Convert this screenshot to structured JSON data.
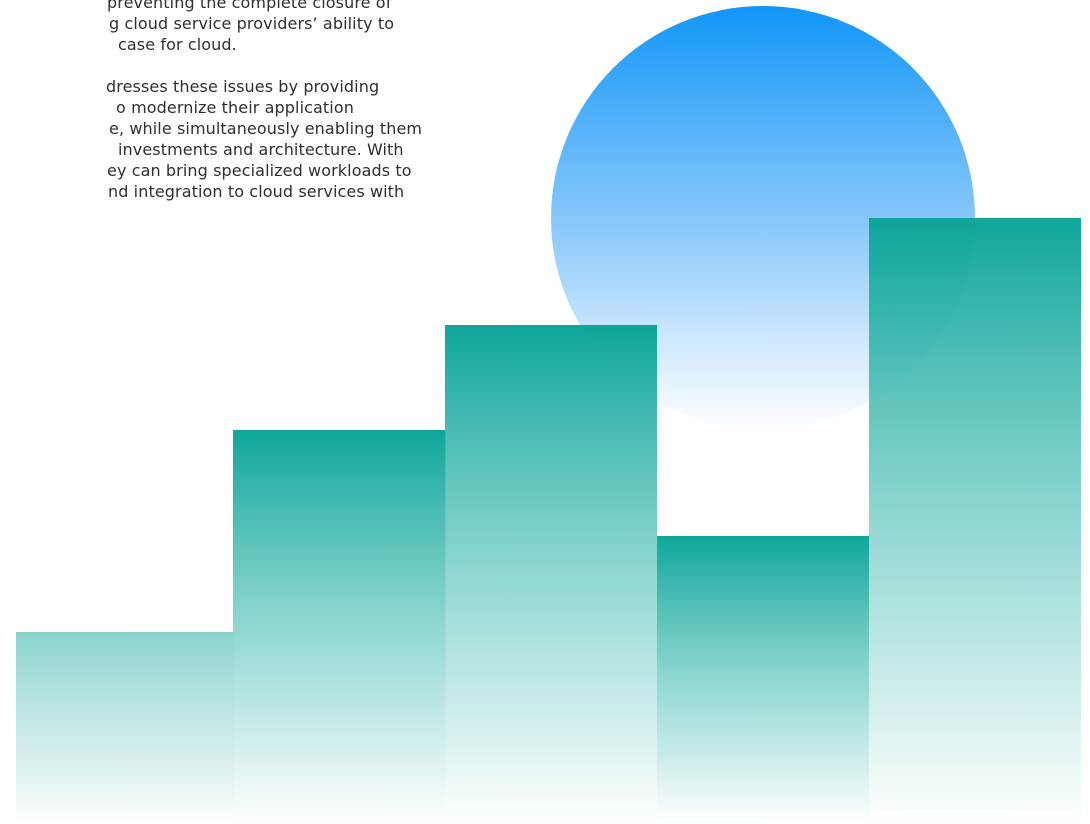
{
  "text": {
    "paragraph_1": [
      "preventing the complete closure of",
      "g cloud service providers’ ability to",
      "case for cloud."
    ],
    "paragraph_2": [
      "dresses these issues by providing",
      "o modernize their application",
      "e, while simultaneously enabling them",
      "investments and architecture. With",
      "ey can bring specialized workloads to",
      "nd integration to cloud services with"
    ]
  },
  "colors": {
    "bar_top": "#0aa498",
    "bar_bottom": "#ffffff",
    "circle_top": "#1196f8",
    "circle_bottom": "#ffffff",
    "text": "#2f2f2f"
  },
  "illustration": {
    "name": "gradient-bars-and-sun",
    "bars": [
      {
        "label": "bar-1",
        "level": 0.36
      },
      {
        "label": "bar-2",
        "level": 0.75
      },
      {
        "label": "bar-3",
        "level": 0.95
      },
      {
        "label": "bar-4",
        "level": 0.55
      },
      {
        "label": "bar-5",
        "level": 1.0
      }
    ]
  }
}
